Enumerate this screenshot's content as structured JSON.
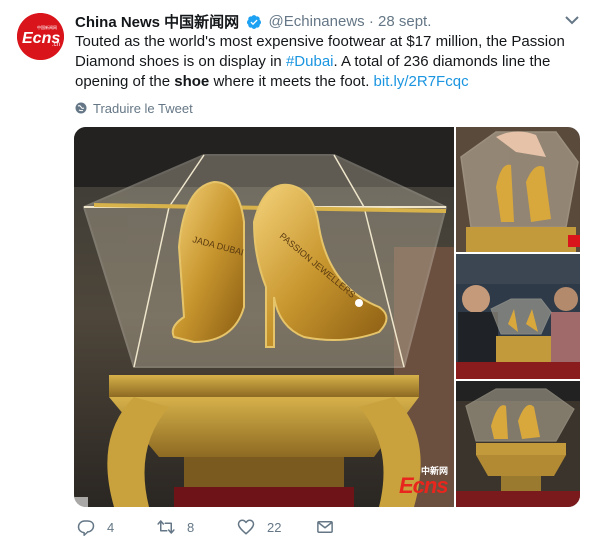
{
  "tweet": {
    "author_name": "China News 中国新闻网",
    "handle": "@Echinanews",
    "separator": "·",
    "date": "28 sept.",
    "text": {
      "part1": "Touted as the world's most expensive footwear at $17 million, the Passion Diamond shoes is on display in ",
      "hashtag": "#Dubai",
      "part2": ". A total of 236 diamonds line the opening of the ",
      "bold_word": "shoe",
      "part3": " where it meets the foot. ",
      "link": "bit.ly/2R7Fcqc"
    },
    "translate_label": "Traduire le Tweet"
  },
  "avatar": {
    "logo_text": "Ecns",
    "sub_text": ".cn",
    "cn_text": "中国新闻网"
  },
  "media": {
    "watermark_cn": "中新网",
    "watermark_logo": "Ecns",
    "shoe_text_left": "JADA DUBAI",
    "shoe_text_right": "PASSION JEWELLERS"
  },
  "actions": {
    "reply_count": "4",
    "retweet_count": "8",
    "like_count": "22"
  },
  "colors": {
    "accent": "#1b95e0",
    "secondary_text": "#657786",
    "avatar_red": "#d9141b"
  },
  "icons": [
    "verified-badge-icon",
    "chevron-down-icon",
    "globe-icon",
    "reply-icon",
    "retweet-icon",
    "like-icon",
    "direct-message-icon"
  ]
}
